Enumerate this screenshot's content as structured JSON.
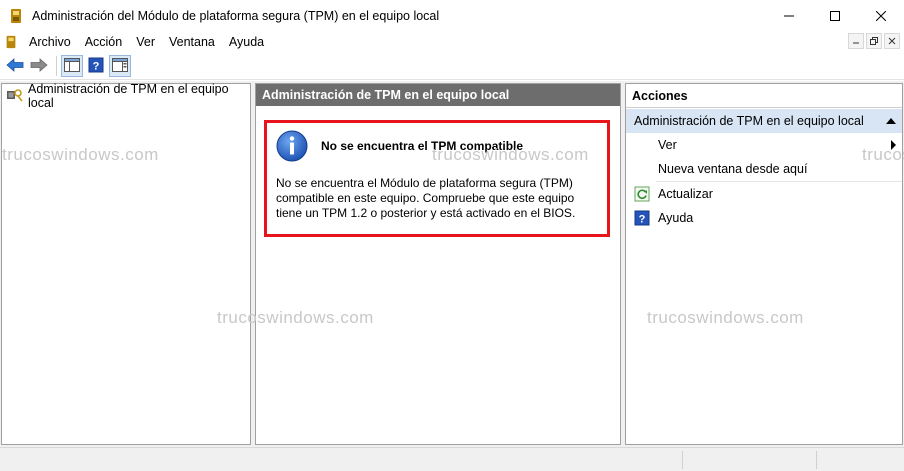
{
  "window": {
    "title": "Administración del Módulo de plataforma segura (TPM) en el equipo local",
    "minimize_glyph": "—",
    "maximize_glyph": "☐",
    "close_glyph": "✕"
  },
  "menu": {
    "items": [
      "Archivo",
      "Acción",
      "Ver",
      "Ventana",
      "Ayuda"
    ],
    "mdi": [
      "–",
      "🗗",
      "✕"
    ]
  },
  "toolbar": {
    "buttons": [
      "back-icon",
      "forward-icon",
      "show-hide-tree-icon",
      "help-icon",
      "show-hide-action-pane-icon"
    ]
  },
  "tree": {
    "root_label": "Administración de TPM en el equipo local"
  },
  "center": {
    "header": "Administración de TPM en el equipo local",
    "message_title": "No se encuentra el TPM compatible",
    "message_body": "No se encuentra el Módulo de plataforma segura (TPM) compatible en este equipo. Compruebe que este equipo tiene un TPM 1.2 o posterior y está activado en el BIOS."
  },
  "actions": {
    "header": "Acciones",
    "section": "Administración de TPM en el equipo local",
    "items": [
      {
        "label": "Ver",
        "icon": "",
        "has_submenu": true
      },
      {
        "label": "Nueva ventana desde aquí",
        "icon": "",
        "has_submenu": false
      },
      {
        "label": "Actualizar",
        "icon": "refresh-icon",
        "has_submenu": false
      },
      {
        "label": "Ayuda",
        "icon": "help-icon",
        "has_submenu": false
      }
    ]
  },
  "watermark": "trucoswindows.com",
  "colors": {
    "highlight_border": "#e8141c",
    "center_header_bg": "#6d6d6d",
    "actions_section_bg": "#d7e5f5",
    "info_icon_blue": "#1f5fc0"
  }
}
